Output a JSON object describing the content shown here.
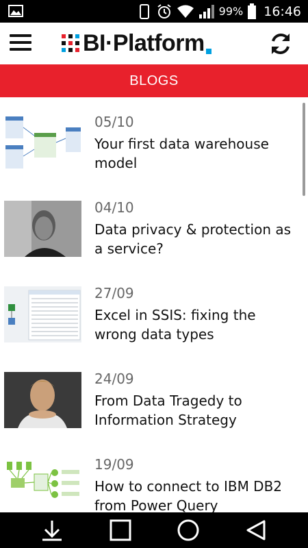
{
  "status_bar": {
    "battery_percent": "99%",
    "time": "16:46",
    "icons": [
      "image-notification-icon",
      "vibrate-icon",
      "alarm-icon",
      "wifi-icon",
      "signal-icon",
      "battery-icon"
    ]
  },
  "app_bar": {
    "menu_icon": "hamburger-menu-icon",
    "logo_text": "BI·Platform",
    "refresh_icon": "refresh-icon"
  },
  "section": {
    "title": "BLOGS"
  },
  "posts": [
    {
      "date": "05/10",
      "title": "Your first data warehouse model",
      "thumb": "data-model-diagram"
    },
    {
      "date": "04/10",
      "title": "Data privacy & protection as a service?",
      "thumb": "portrait-photo"
    },
    {
      "date": "27/09",
      "title": "Excel in SSIS: fixing the wrong data types",
      "thumb": "ssis-screenshot"
    },
    {
      "date": "24/09",
      "title": "From Data Tragedy to Information Strategy",
      "thumb": "portrait-photo"
    },
    {
      "date": "19/09",
      "title": "How to connect to IBM DB2 from Power Query",
      "thumb": "power-query-diagram"
    }
  ],
  "nav_bar": {
    "icons": [
      "download-icon",
      "recents-icon",
      "home-icon",
      "back-icon"
    ]
  },
  "colors": {
    "accent_red": "#e8212c",
    "logo_blue": "#00a0e0",
    "text_dark": "#111111",
    "date_gray": "#666666"
  }
}
